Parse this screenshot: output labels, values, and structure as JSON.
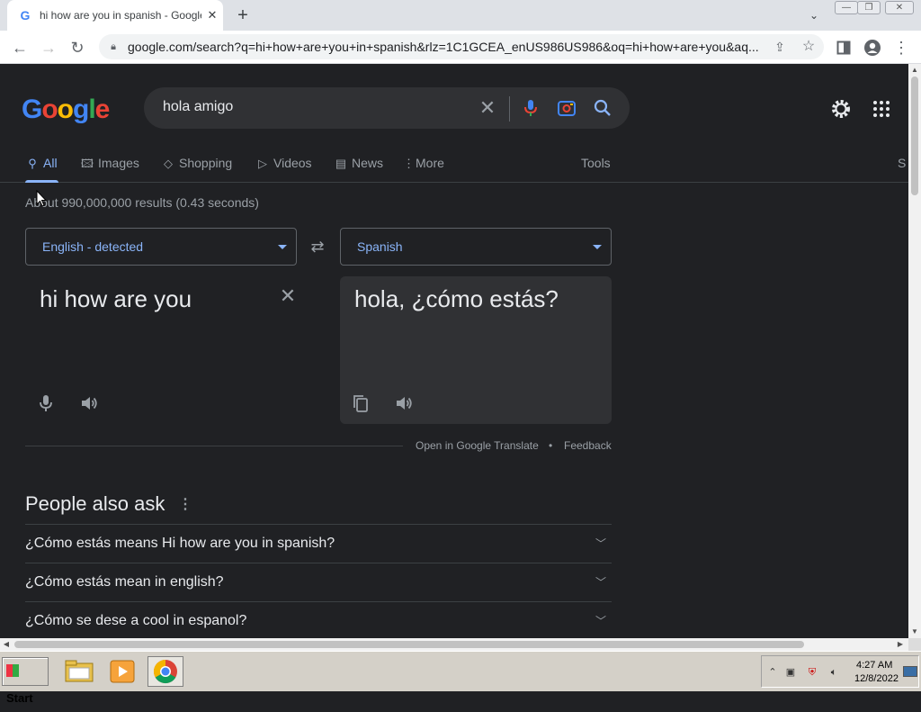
{
  "browser": {
    "tab_title": "hi how are you in spanish - Google",
    "tab_favicon": "G",
    "url": "google.com/search?q=hi+how+are+you+in+spanish&rlz=1C1GCEA_enUS986US986&oq=hi+how+are+you&aq..."
  },
  "search": {
    "logo_text": "Google",
    "query": "hola amigo"
  },
  "tabs": [
    {
      "label": "All",
      "icon": "search-icon"
    },
    {
      "label": "Images",
      "icon": "image-icon"
    },
    {
      "label": "Shopping",
      "icon": "tag-icon"
    },
    {
      "label": "Videos",
      "icon": "play-icon"
    },
    {
      "label": "News",
      "icon": "newspaper-icon"
    },
    {
      "label": "More",
      "icon": "kebab-icon"
    }
  ],
  "tools_label": "Tools",
  "edge_label": "S",
  "result_stats": "About 990,000,000 results (0.43 seconds)",
  "translate": {
    "source_lang": "English - detected",
    "target_lang": "Spanish",
    "source_text": "hi how are you",
    "target_text": "hola, ¿cómo estás?",
    "open_link": "Open in Google Translate",
    "separator": "•",
    "feedback": "Feedback"
  },
  "people_also_ask": {
    "title": "People also ask",
    "questions": [
      "¿Cómo estás means Hi how are you in spanish?",
      "¿Cómo estás mean in english?",
      "¿Cómo se dese a cool in espanol?"
    ]
  },
  "taskbar": {
    "start_label": "Start",
    "time": "4:27 AM",
    "date": "12/8/2022"
  },
  "colors": {
    "page_bg": "#202124",
    "accent": "#8ab4f8",
    "text": "#e8eaed",
    "muted": "#9aa0a6"
  }
}
